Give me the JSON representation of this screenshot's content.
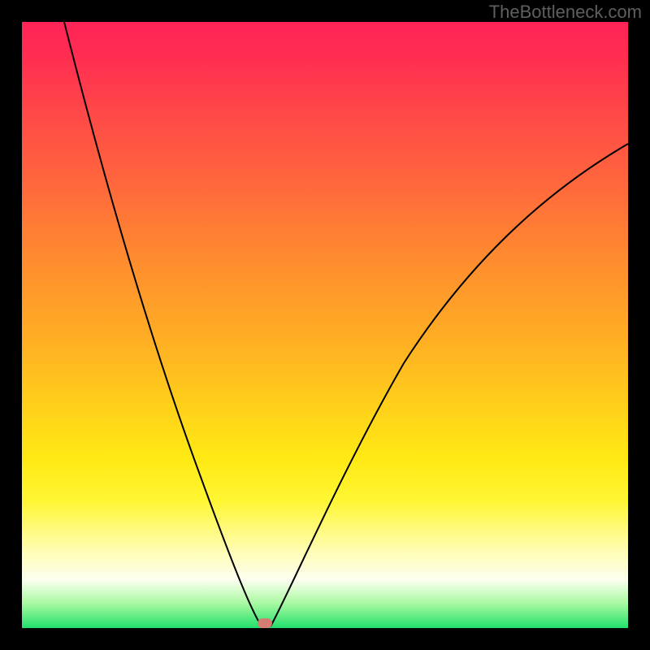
{
  "watermark": "TheBottleneck.com",
  "colors": {
    "background": "#000000",
    "gradient_top": "#ff2457",
    "gradient_bottom": "#22e06c",
    "curve": "#000000",
    "marker": "#d47d73"
  },
  "chart_data": {
    "type": "line",
    "title": "",
    "xlabel": "",
    "ylabel": "",
    "xlim": [
      0,
      100
    ],
    "ylim": [
      0,
      100
    ],
    "left_branch": {
      "x": [
        7,
        10,
        14,
        19,
        24,
        28,
        32,
        35,
        37,
        38.5,
        39.5
      ],
      "y": [
        100,
        86,
        69,
        51,
        35,
        21,
        10,
        4,
        1,
        0.2,
        0
      ]
    },
    "right_branch": {
      "x": [
        41,
        43,
        47,
        53,
        60,
        68,
        77,
        87,
        97,
        100
      ],
      "y": [
        0,
        4,
        14,
        28,
        42,
        54,
        64,
        72,
        78,
        80
      ]
    },
    "marker": {
      "x": 40,
      "y": 0
    },
    "annotations": [
      "TheBottleneck.com"
    ]
  }
}
